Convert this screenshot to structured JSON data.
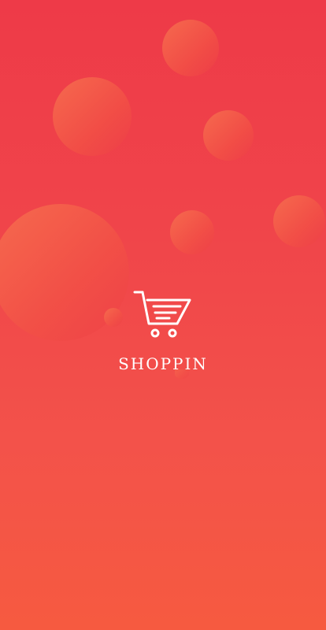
{
  "splash": {
    "brand_name": "SHOPPIN",
    "logo_icon": "shopping-cart-icon",
    "colors": {
      "background_top": "#ee3a48",
      "background_bottom": "#f65a40",
      "bubble": "#f46c4e",
      "foreground": "#ffffff"
    }
  }
}
